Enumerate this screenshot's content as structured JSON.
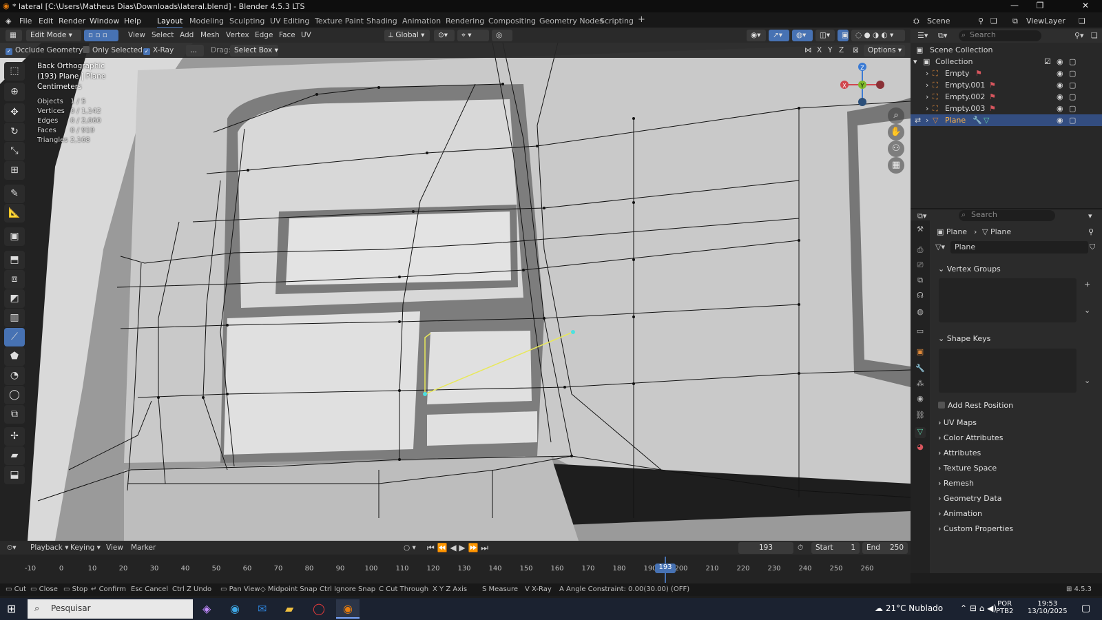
{
  "window": {
    "title": "* lateral [C:\\Users\\Matheus Dias\\Downloads\\lateral.blend] - Blender 4.5.3 LTS"
  },
  "menu": [
    "File",
    "Edit",
    "Render",
    "Window",
    "Help"
  ],
  "workspaces": [
    "Layout",
    "Modeling",
    "Sculpting",
    "UV Editing",
    "Texture Paint",
    "Shading",
    "Animation",
    "Rendering",
    "Compositing",
    "Geometry Nodes",
    "Scripting"
  ],
  "active_workspace": "Layout",
  "scene": {
    "label": "Scene",
    "view_layer": "ViewLayer"
  },
  "header": {
    "mode": "Edit Mode",
    "menus": [
      "View",
      "Select",
      "Add",
      "Mesh",
      "Vertex",
      "Edge",
      "Face",
      "UV"
    ],
    "orientation": "Global",
    "search_placeholder": "Search"
  },
  "header2": {
    "occlude": "Occlude Geometry",
    "only_selected": "Only Selected",
    "xray": "X-Ray",
    "more": "...",
    "drag_label": "Drag:",
    "drag_value": "Select Box",
    "axes": [
      "X",
      "Y",
      "Z"
    ],
    "options": "Options"
  },
  "viewport": {
    "view_name": "Back Orthographic",
    "object_line": "(193) Plane | Plane",
    "units": "Centimeters",
    "stats": [
      {
        "label": "Objects",
        "value": "1 / 5"
      },
      {
        "label": "Vertices",
        "value": "0 / 1,142"
      },
      {
        "label": "Edges",
        "value": "0 / 2,060"
      },
      {
        "label": "Faces",
        "value": "0 / 919"
      },
      {
        "label": "Triangles",
        "value": "2,168"
      }
    ],
    "gizmo_axes": [
      "X",
      "Y",
      "Z"
    ]
  },
  "outliner": {
    "search_placeholder": "Search",
    "root": "Scene Collection",
    "collection": "Collection",
    "items": [
      "Empty",
      "Empty.001",
      "Empty.002",
      "Empty.003",
      "Plane"
    ],
    "selected": "Plane"
  },
  "properties": {
    "search_placeholder": "Search",
    "breadcrumb": [
      "Plane",
      "Plane"
    ],
    "mesh_name": "Plane",
    "sections_open": [
      "Vertex Groups",
      "Shape Keys"
    ],
    "add_rest_position": "Add Rest Position",
    "sections_closed": [
      "UV Maps",
      "Color Attributes",
      "Attributes",
      "Texture Space",
      "Remesh",
      "Geometry Data",
      "Animation",
      "Custom Properties"
    ]
  },
  "timeline": {
    "menus": [
      "Playback",
      "Keying",
      "View",
      "Marker"
    ],
    "current_frame": "193",
    "start_label": "Start",
    "start": "1",
    "end_label": "End",
    "end": "250",
    "ticks": [
      "-10",
      "0",
      "10",
      "20",
      "30",
      "40",
      "50",
      "60",
      "70",
      "80",
      "90",
      "100",
      "110",
      "120",
      "130",
      "140",
      "150",
      "160",
      "170",
      "180",
      "190",
      "200",
      "210",
      "220",
      "230",
      "240",
      "250",
      "260"
    ],
    "playhead": "193"
  },
  "statusbar": {
    "items": [
      "Cut",
      "Close",
      "Stop",
      "Confirm",
      "Cancel",
      "Undo",
      "Pan View",
      "Midpoint Snap",
      "Ignore Snap",
      "Cut Through",
      "Axis",
      "Measure",
      "X-Ray",
      "Angle Constraint: 0.00(30.00) (OFF)"
    ],
    "keys": [
      "",
      "",
      "",
      "",
      "Esc",
      "Ctrl Z",
      "",
      "",
      "Ctrl",
      "C",
      "X Y Z",
      "S",
      "V",
      "A"
    ],
    "version": "4.5.3"
  },
  "taskbar": {
    "search_placeholder": "Pesquisar",
    "weather": "21°C  Nublado",
    "lang": "POR",
    "lang2": "PTB2",
    "time": "19:53",
    "date": "13/10/2025"
  },
  "colors": {
    "accent": "#4772b3",
    "selected_row": "#334d80",
    "playhead": "#4772b3",
    "cut_line": "#e8e85a",
    "vertex": "#4ee0e0"
  }
}
